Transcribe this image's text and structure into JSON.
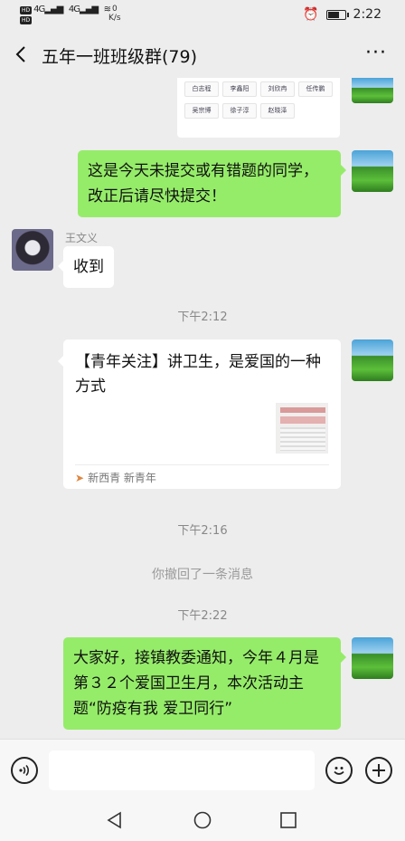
{
  "status_bar": {
    "network_badge_1": "HD",
    "network_badge_2": "HD",
    "signal_1": "4G",
    "signal_2": "4G",
    "speed_value": "0",
    "speed_unit": "K/s",
    "time": "2:22",
    "battery_level": 0.6
  },
  "header": {
    "title": "五年一班班级群(79)",
    "back_icon": "chevron-left-icon",
    "more_icon": "more-dots-icon",
    "more_label": "···"
  },
  "messages": {
    "name_chips": [
      "白志程",
      "李鑫阳",
      "刘欣冉",
      "任传鹏",
      "吴宗博",
      "徐子淳",
      "赵晓泽"
    ],
    "msg1": {
      "sender": "me",
      "text": "这是今天未提交或有错题的同学，改正后请尽快提交！"
    },
    "msg2": {
      "sender_name": "王文义",
      "text": "收到"
    },
    "time1": "下午2:12",
    "article": {
      "title": "【青年关注】讲卫生，是爱国的一种方式",
      "source": "新西青 新青年"
    },
    "time2": "下午2:16",
    "recall_notice": "你撤回了一条消息",
    "time3": "下午2:22",
    "msg3": {
      "sender": "me",
      "text": "大家好，接镇教委通知，今年４月是第３２个爱国卫生月，本次活动主题“防疫有我 爱卫同行”"
    }
  },
  "input_bar": {
    "voice_icon": "voice-icon",
    "emoji_icon": "emoji-icon",
    "plus_icon": "plus-icon",
    "text_value": ""
  },
  "nav_bar": {
    "back_icon": "triangle-back-icon",
    "home_icon": "circle-home-icon",
    "recent_icon": "square-recent-icon"
  },
  "colors": {
    "my_bubble": "#95ec69",
    "other_bubble": "#ffffff",
    "background": "#ededed"
  }
}
